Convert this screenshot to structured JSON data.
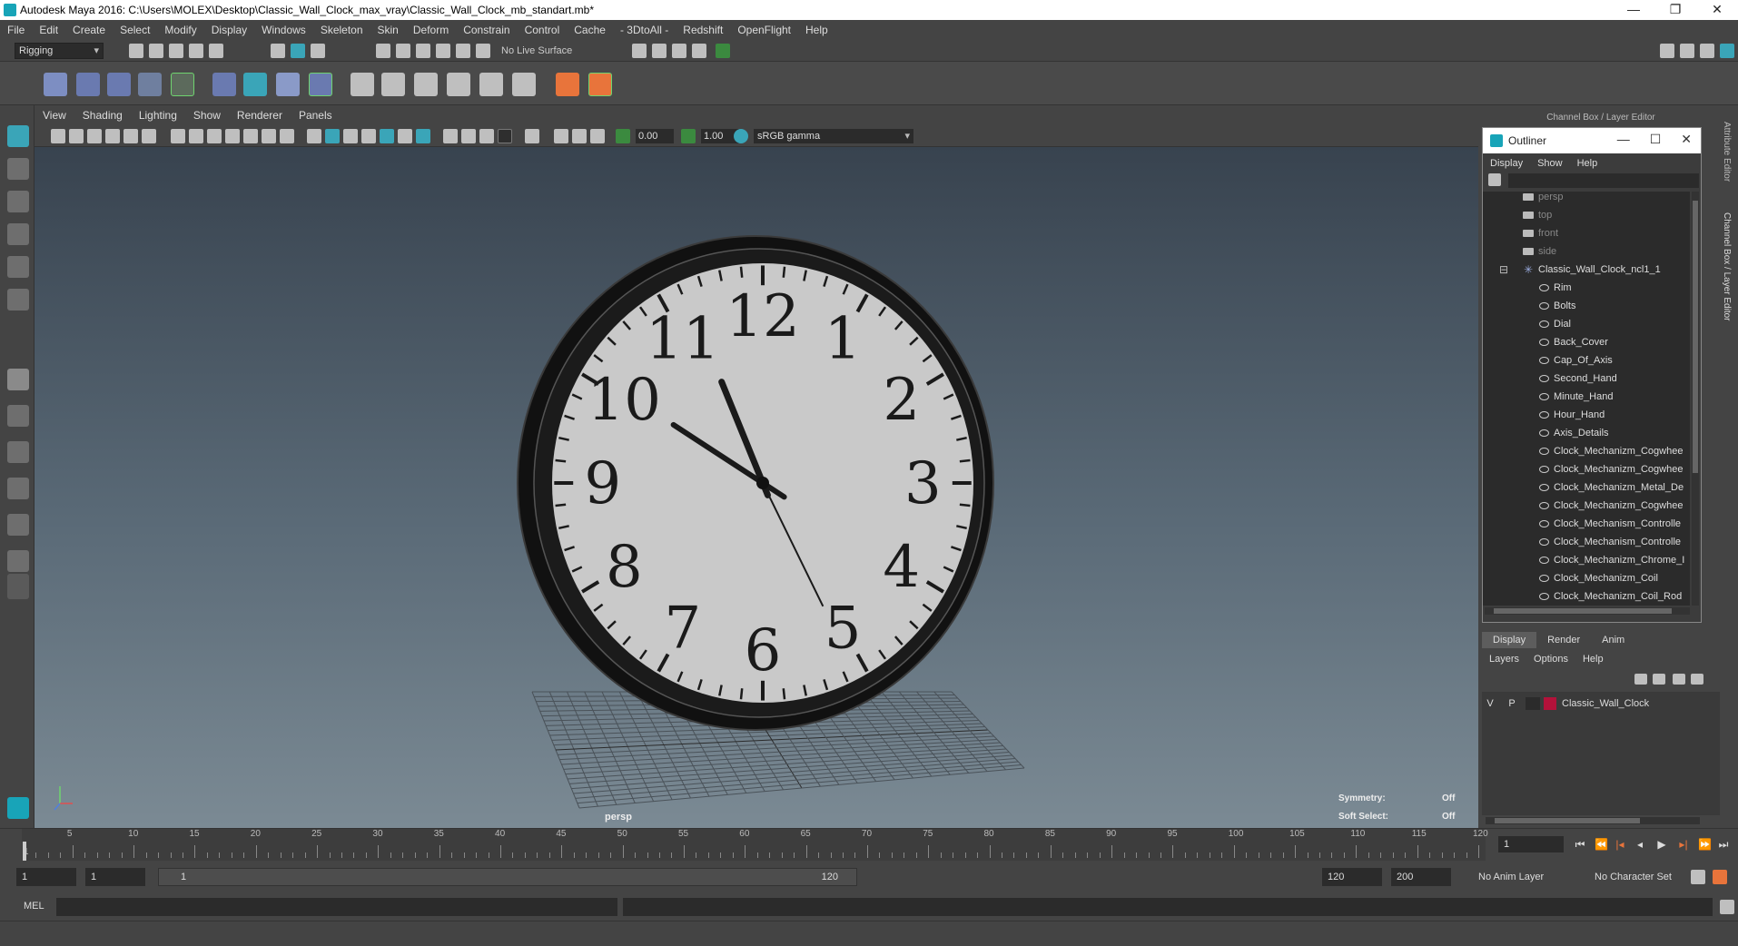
{
  "window": {
    "title": "Autodesk Maya 2016: C:\\Users\\MOLEX\\Desktop\\Classic_Wall_Clock_max_vray\\Classic_Wall_Clock_mb_standart.mb*",
    "minimize": "—",
    "restore": "❐",
    "close": "✕"
  },
  "menubar": [
    "File",
    "Edit",
    "Create",
    "Select",
    "Modify",
    "Display",
    "Windows",
    "Skeleton",
    "Skin",
    "Deform",
    "Constrain",
    "Control",
    "Cache",
    "- 3DtoAll -",
    "Redshift",
    "OpenFlight",
    "Help"
  ],
  "status_line": {
    "mode": "Rigging",
    "live_surface": "No Live Surface"
  },
  "viewport": {
    "menu": [
      "View",
      "Shading",
      "Lighting",
      "Show",
      "Renderer",
      "Panels"
    ],
    "exposure": "0.00",
    "gamma_value": "1.00",
    "color_space": "sRGB gamma",
    "camera_label": "persp",
    "symmetry_label": "Symmetry:",
    "symmetry_value": "Off",
    "soft_select_label": "Soft Select:",
    "soft_select_value": "Off"
  },
  "clock": {
    "numerals": [
      "12",
      "1",
      "2",
      "3",
      "4",
      "5",
      "6",
      "7",
      "8",
      "9",
      "10",
      "11"
    ],
    "hour_hand_angle": 337,
    "minute_hand_angle": 302,
    "second_hand_angle": 153
  },
  "side_panel": {
    "title": "Channel Box / Layer Editor",
    "tabs_vertical": [
      "Attribute Editor",
      "Channel Box / Layer Editor"
    ]
  },
  "outliner": {
    "title": "Outliner",
    "menu": [
      "Display",
      "Show",
      "Help"
    ],
    "items": [
      {
        "label": "persp",
        "type": "camera",
        "dim": true
      },
      {
        "label": "top",
        "type": "camera",
        "dim": true
      },
      {
        "label": "front",
        "type": "camera",
        "dim": true
      },
      {
        "label": "side",
        "type": "camera",
        "dim": true
      },
      {
        "label": "Classic_Wall_Clock_ncl1_1",
        "type": "group",
        "dim": false
      },
      {
        "label": "Rim",
        "type": "mesh",
        "dim": false
      },
      {
        "label": "Bolts",
        "type": "mesh",
        "dim": false
      },
      {
        "label": "Dial",
        "type": "mesh",
        "dim": false
      },
      {
        "label": "Back_Cover",
        "type": "mesh",
        "dim": false
      },
      {
        "label": "Cap_Of_Axis",
        "type": "mesh",
        "dim": false
      },
      {
        "label": "Second_Hand",
        "type": "mesh",
        "dim": false
      },
      {
        "label": "Minute_Hand",
        "type": "mesh",
        "dim": false
      },
      {
        "label": "Hour_Hand",
        "type": "mesh",
        "dim": false
      },
      {
        "label": "Axis_Details",
        "type": "mesh",
        "dim": false
      },
      {
        "label": "Clock_Mechanizm_Cogwhee",
        "type": "mesh",
        "dim": false
      },
      {
        "label": "Clock_Mechanizm_Cogwhee",
        "type": "mesh",
        "dim": false
      },
      {
        "label": "Clock_Mechanizm_Metal_De",
        "type": "mesh",
        "dim": false
      },
      {
        "label": "Clock_Mechanizm_Cogwhee",
        "type": "mesh",
        "dim": false
      },
      {
        "label": "Clock_Mechanism_Controlle",
        "type": "mesh",
        "dim": false
      },
      {
        "label": "Clock_Mechanism_Controlle",
        "type": "mesh",
        "dim": false
      },
      {
        "label": "Clock_Mechanizm_Chrome_I",
        "type": "mesh",
        "dim": false
      },
      {
        "label": "Clock_Mechanizm_Coil",
        "type": "mesh",
        "dim": false
      },
      {
        "label": "Clock_Mechanizm_Coil_Rod",
        "type": "mesh",
        "dim": false
      }
    ]
  },
  "layer_editor": {
    "tabs": [
      "Display",
      "Render",
      "Anim"
    ],
    "menu": [
      "Layers",
      "Options",
      "Help"
    ],
    "layer": {
      "v": "V",
      "p": "P",
      "name": "Classic_Wall_Clock",
      "color": "#b3123a"
    }
  },
  "timeline": {
    "ticks": [
      "5",
      "10",
      "15",
      "20",
      "25",
      "30",
      "35",
      "40",
      "45",
      "50",
      "55",
      "60",
      "65",
      "70",
      "75",
      "80",
      "85",
      "90",
      "95",
      "100",
      "105",
      "110",
      "115",
      "120"
    ],
    "start_label": "1",
    "current_frame": "1",
    "playback_icons": [
      "⏮",
      "⏪",
      "|◂",
      "◂",
      "▶",
      "▸|",
      "⏩",
      "⏭"
    ]
  },
  "range": {
    "start": "1",
    "playback_start": "1",
    "slider_start": "1",
    "slider_end": "120",
    "playback_end": "120",
    "end": "200",
    "anim_layer": "No Anim Layer",
    "character_set": "No Character Set"
  },
  "command_line": {
    "label": "MEL"
  }
}
